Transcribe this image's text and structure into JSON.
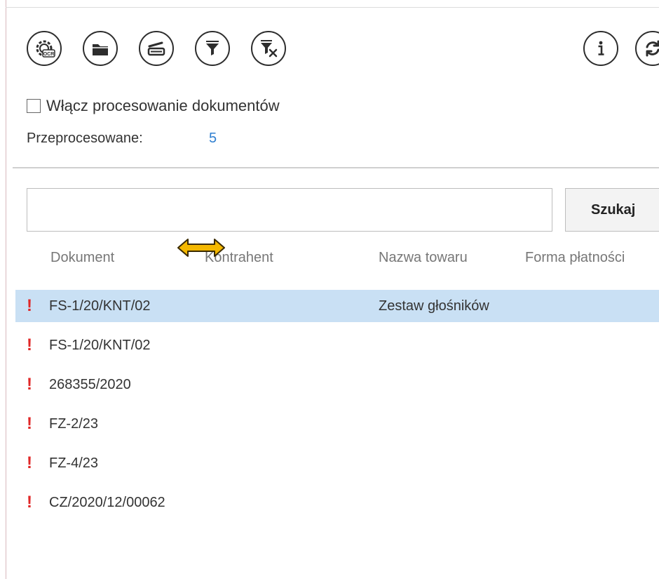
{
  "toolbar": {
    "buttons": [
      {
        "name": "ocr-settings",
        "icon": "gear-ocr-icon",
        "ocr_text": "OCR"
      },
      {
        "name": "open-folder",
        "icon": "folder-icon"
      },
      {
        "name": "scanner",
        "icon": "scanner-icon"
      },
      {
        "name": "filter",
        "icon": "filter-icon"
      },
      {
        "name": "clear-filter",
        "icon": "filter-clear-icon"
      },
      {
        "name": "info",
        "icon": "info-icon"
      },
      {
        "name": "refresh",
        "icon": "refresh-icon"
      }
    ]
  },
  "processing": {
    "enable_label": "Włącz procesowanie dokumentów",
    "enabled": false,
    "processed_label": "Przeprocesowane:",
    "processed_count": "5",
    "count_color": "#2f7fd0"
  },
  "search": {
    "value": "",
    "button_label": "Szukaj"
  },
  "columns": [
    "Dokument",
    "Kontrahent",
    "Nazwa towaru",
    "Forma płatności"
  ],
  "rows": [
    {
      "flag": "!",
      "dokument": "FS-1/20/KNT/02",
      "nazwa_towaru": "Zestaw głośników",
      "selected": true
    },
    {
      "flag": "!",
      "dokument": "FS-1/20/KNT/02",
      "nazwa_towaru": "",
      "selected": false
    },
    {
      "flag": "!",
      "dokument": "268355/2020",
      "nazwa_towaru": "",
      "selected": false
    },
    {
      "flag": "!",
      "dokument": "FZ-2/23",
      "nazwa_towaru": "",
      "selected": false
    },
    {
      "flag": "!",
      "dokument": "FZ-4/23",
      "nazwa_towaru": "",
      "selected": false
    },
    {
      "flag": "!",
      "dokument": "CZ/2020/12/00062",
      "nazwa_towaru": "",
      "selected": false
    }
  ],
  "colors": {
    "selected_row": "#c9e0f4",
    "flag": "#e02727",
    "resize_cursor": "#f5b800"
  }
}
